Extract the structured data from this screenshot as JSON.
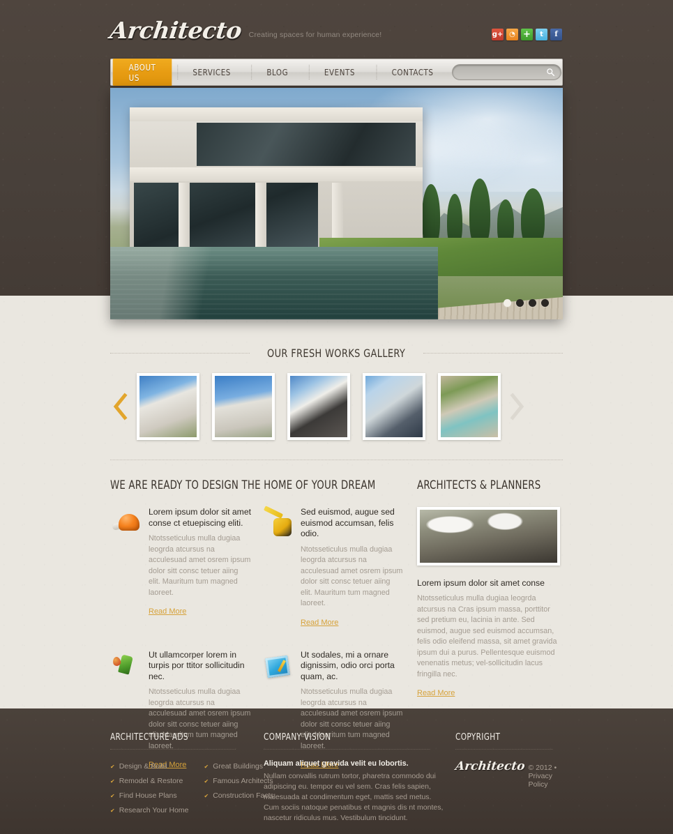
{
  "brand": {
    "logo": "Architecto",
    "tagline": "Creating spaces for human experience!"
  },
  "social": [
    {
      "name": "google-plus",
      "glyph": "g+"
    },
    {
      "name": "rss",
      "glyph": "◔"
    },
    {
      "name": "share",
      "glyph": "+"
    },
    {
      "name": "twitter",
      "glyph": "t"
    },
    {
      "name": "facebook",
      "glyph": "f"
    }
  ],
  "nav": {
    "items": [
      {
        "label": "ABOUT US",
        "active": true
      },
      {
        "label": "SERVICES",
        "active": false
      },
      {
        "label": "BLOG",
        "active": false
      },
      {
        "label": "EVENTS",
        "active": false
      },
      {
        "label": "CONTACTS",
        "active": false
      }
    ]
  },
  "search": {
    "value": "",
    "placeholder": ""
  },
  "slider": {
    "dots": 4,
    "active_index": 0
  },
  "gallery": {
    "heading": "OUR FRESH WORKS GALLERY",
    "prev_label": "‹",
    "next_label": "›",
    "thumbs": [
      {
        "alt": "modern white villa"
      },
      {
        "alt": "curved office building"
      },
      {
        "alt": "concrete box house"
      },
      {
        "alt": "glass dome structure"
      },
      {
        "alt": "terrace pool"
      }
    ]
  },
  "main": {
    "left_heading": "WE ARE READY TO DESIGN THE HOME OF YOUR DREAM",
    "features": [
      {
        "icon": "helmet-icon",
        "title": "Lorem ipsum dolor sit amet conse ct etuepiscing eliti.",
        "text": "Ntotsseticulus mulla dugiaa leogrda atcursus na acculesuad amet osrem ipsum dolor sitt consc tetuer aiing elit. Mauritum tum magned laoreet.",
        "link": "Read More"
      },
      {
        "icon": "tape-measure-icon",
        "title": "Sed euismod, augue sed euismod accumsan, felis odio.",
        "text": "Ntotsseticulus mulla dugiaa leogrda atcursus na acculesuad amet osrem ipsum dolor sitt consc tetuer aiing elit. Mauritum tum magned laoreet.",
        "link": "Read More"
      },
      {
        "icon": "fuel-nozzle-icon",
        "title": "Ut ullamcorper lorem in turpis por ttitor sollicitudin nec.",
        "text": "Ntotsseticulus mulla dugiaa leogrda atcursus na acculesuad amet osrem ipsum dolor sitt consc tetuer aiing elit. Mauritum tum magned laoreet.",
        "link": "Read More"
      },
      {
        "icon": "blueprint-icon",
        "title": "Ut sodales, mi a ornare dignissim, odio orci porta quam, ac.",
        "text": "Ntotsseticulus mulla dugiaa leogrda atcursus na acculesuad amet osrem ipsum dolor sitt consc tetuer aiing elit. Mauritum tum magned laoreet.",
        "link": "Read More"
      }
    ],
    "right_heading": "ARCHITECTS & PLANNERS",
    "right_card": {
      "photo_alt": "two architects in hard hats",
      "title": "Lorem ipsum dolor sit amet conse",
      "text": "Ntotsseticulus mulla dugiaa leogrda atcursus na Cras ipsum massa, porttitor sed pretium eu, lacinia in ante. Sed euismod, augue sed euismod accumsan, felis odio eleifend massa, sit amet gravida ipsum dui a purus. Pellentesque euismod venenatis metus; vel-sollicitudin lacus fringilla nec.",
      "link": "Read More"
    }
  },
  "footer": {
    "ads_heading": "ARCHITECTURE ADS",
    "ads_col1": [
      "Design & Build",
      "Remodel & Restore",
      "Find House Plans",
      "Research Your Home"
    ],
    "ads_col2": [
      "Great Buildings",
      "Famous Architects",
      "Construction Facts"
    ],
    "vision_heading": "COMPANY VISION",
    "vision_lead": "Aliquam aliquet gravida velit eu lobortis.",
    "vision_text": "Nullam convallis rutrum tortor, pharetra commodo dui adipiscing eu. tempor eu vel sem. Cras felis sapien, malesuada at condimentum eget, mattis sed metus. Cum sociis natoque penatibus et magnis dis nt montes, nascetur ridiculus mus. Vestibulum tincidunt.",
    "copyright_heading": "COPYRIGHT",
    "copyright_logo": "Architecto",
    "copyright_text": "© 2012 • Privacy Policy"
  },
  "colors": {
    "accent": "#e79c12",
    "dark": "#443b35",
    "link": "#d6a23a",
    "page_bg": "#eae7e0"
  }
}
